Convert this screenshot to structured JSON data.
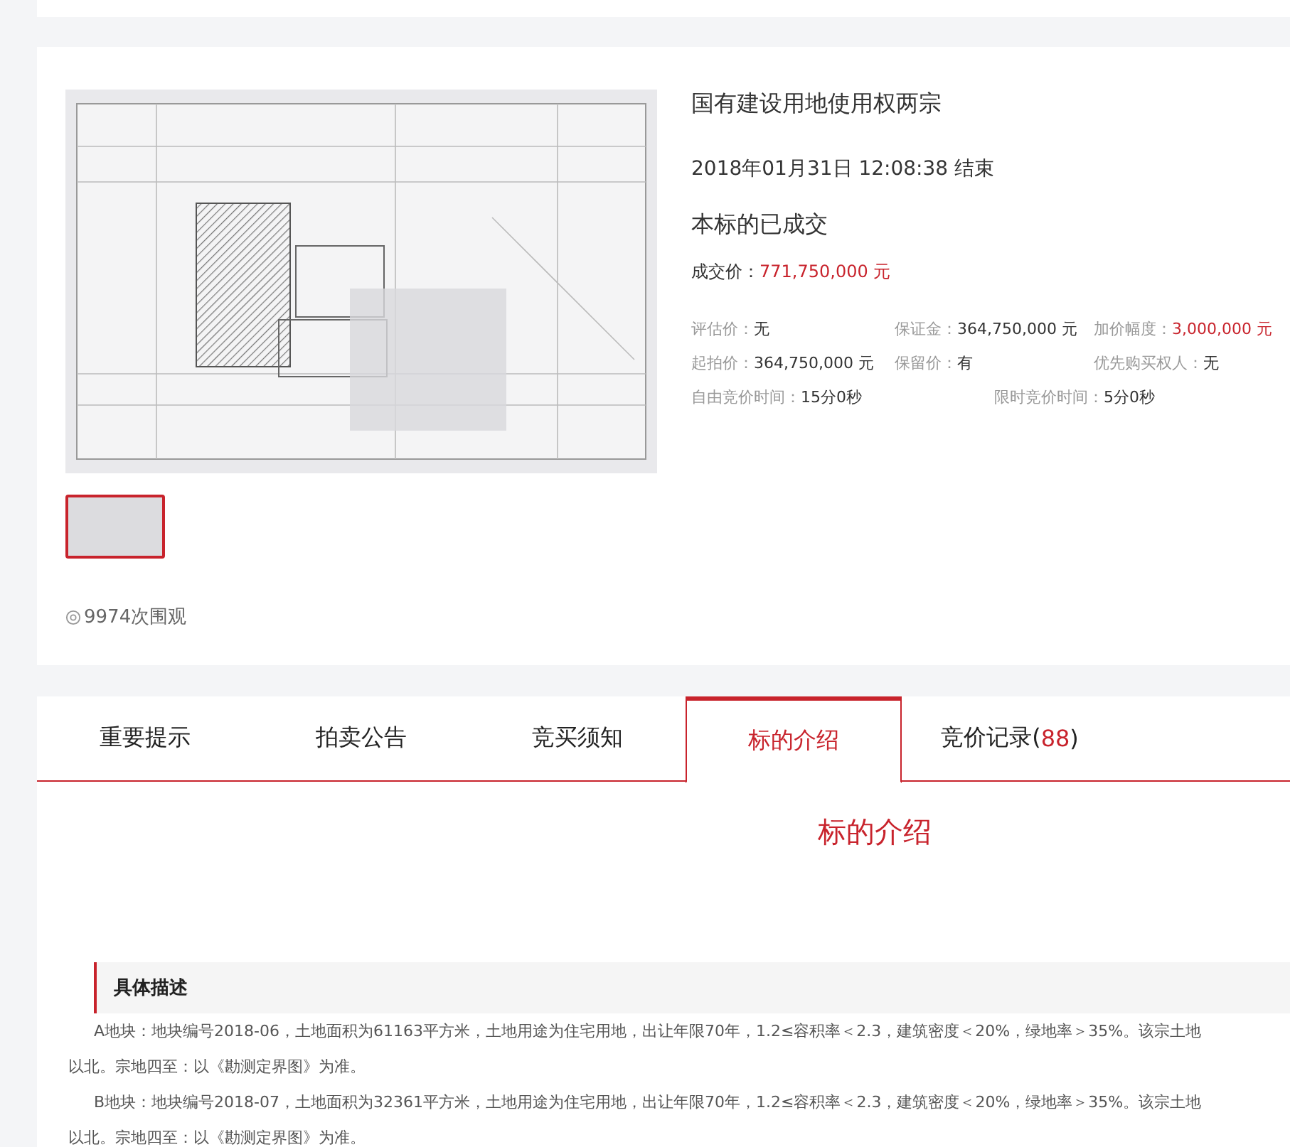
{
  "lot": {
    "title": "国有建设用地使用权两宗",
    "end_time": "2018年01月31日  12:08:38 结束",
    "status": "本标的已成交",
    "deal_label": "成交价：",
    "deal_price": "771,750,000 元",
    "views": "9974次围观",
    "thumbnails": [
      {
        "selected": true
      }
    ]
  },
  "details": [
    {
      "label": "评估价：",
      "value": "无",
      "emphasis": false
    },
    {
      "label": "保证金：",
      "value": "364,750,000 元",
      "emphasis": false
    },
    {
      "label": "加价幅度：",
      "value": "3,000,000 元",
      "emphasis": true
    },
    {
      "label": "起拍价：",
      "value": "364,750,000 元",
      "emphasis": false
    },
    {
      "label": "保留价：",
      "value": "有",
      "emphasis": false
    },
    {
      "label": "优先购买权人：",
      "value": "无",
      "emphasis": false
    },
    {
      "label": "自由竞价时间：",
      "value": "15分0秒",
      "emphasis": false
    },
    {
      "label": "限时竞价时间：",
      "value": "5分0秒",
      "emphasis": false
    }
  ],
  "tabs": [
    {
      "label": "重要提示",
      "selected": false
    },
    {
      "label": "拍卖公告",
      "selected": false
    },
    {
      "label": "竞买须知",
      "selected": false
    },
    {
      "label": "标的介绍",
      "selected": true
    },
    {
      "label": "竞价记录(",
      "count": "88",
      "label_end": ")",
      "selected": false
    }
  ],
  "section": {
    "heading": "标的介绍",
    "subheading": "具体描述",
    "lines": [
      {
        "text": "A地块：地块编号2018-06，土地面积为61163平方米，土地用途为住宅用地，出让年限70年，1.2≤容积率＜2.3，建筑密度＜20%，绿地率＞35%。该宗土地",
        "indent": true
      },
      {
        "text": "以北。宗地四至：以《勘测定界图》为准。",
        "indent": false
      },
      {
        "text": "B地块：地块编号2018-07，土地面积为32361平方米，土地用途为住宅用地，出让年限70年，1.2≤容积率＜2.3，建筑密度＜20%，绿地率＞35%。该宗土地",
        "indent": true
      },
      {
        "text": "以北。宗地四至：以《勘测定界图》为准。",
        "indent": false
      }
    ]
  }
}
